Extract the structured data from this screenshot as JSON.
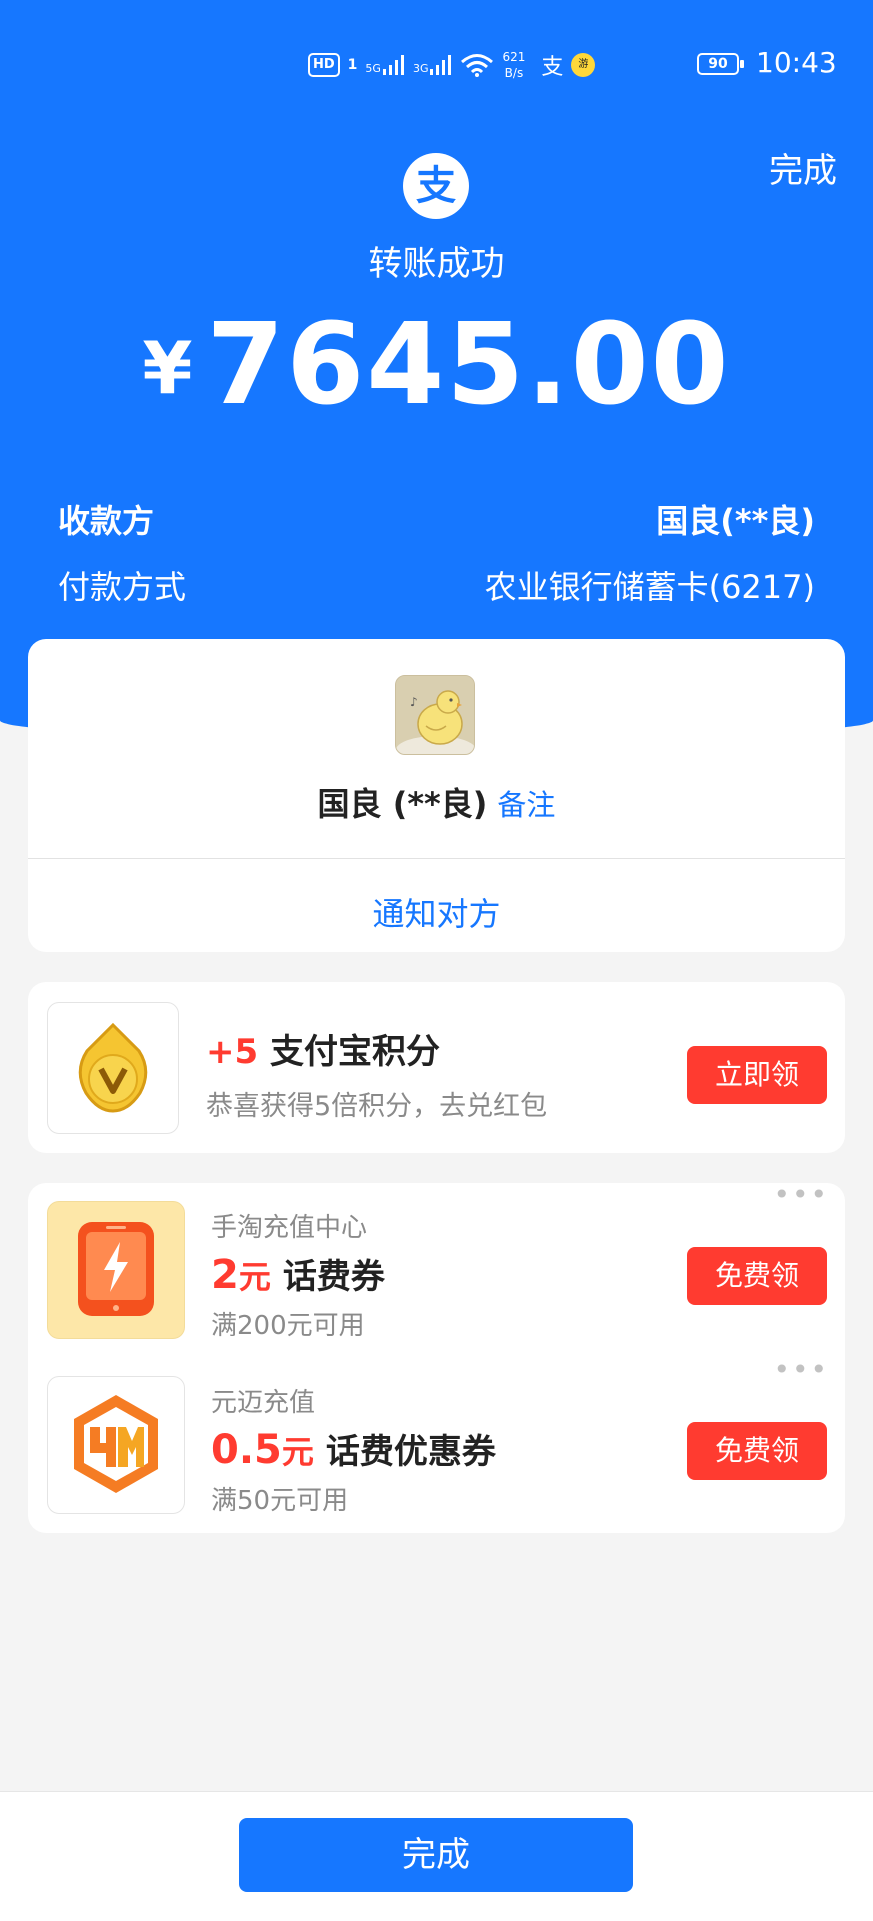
{
  "status_bar": {
    "hd": "HD",
    "sim": "1",
    "signal1": "5G",
    "signal2": "3G",
    "net_speed_value": "621",
    "net_speed_unit": "B/s",
    "app_glyph": "支",
    "mini_badge": "游",
    "battery": "90",
    "time": "10:43"
  },
  "header": {
    "done_label": "完成",
    "logo_glyph": "支",
    "title": "转账成功",
    "currency": "¥",
    "amount": "7645.00"
  },
  "payee": {
    "label": "收款方",
    "value": "国良(**良)"
  },
  "payment_method": {
    "label": "付款方式",
    "value": "农业银行储蓄卡(6217)"
  },
  "user_card": {
    "name": "国良 (**良)",
    "memo_label": "备注",
    "notify_label": "通知对方"
  },
  "points_card": {
    "points": "+5",
    "title": "支付宝积分",
    "subtitle": "恭喜获得5倍积分，去兑红包",
    "button": "立即领"
  },
  "coupons": [
    {
      "shop": "手淘充值中心",
      "amount": "2",
      "unit": "元",
      "name": "话费券",
      "condition": "满200元可用",
      "button": "免费领"
    },
    {
      "shop": "元迈充值",
      "amount": "0.5",
      "unit": "元",
      "name": "话费优惠券",
      "condition": "满50元可用",
      "button": "免费领"
    }
  ],
  "footer": {
    "done_label": "完成"
  },
  "colors": {
    "brand_blue": "#1677ff",
    "accent_red": "#ff3b30",
    "background": "#f4f4f4"
  }
}
